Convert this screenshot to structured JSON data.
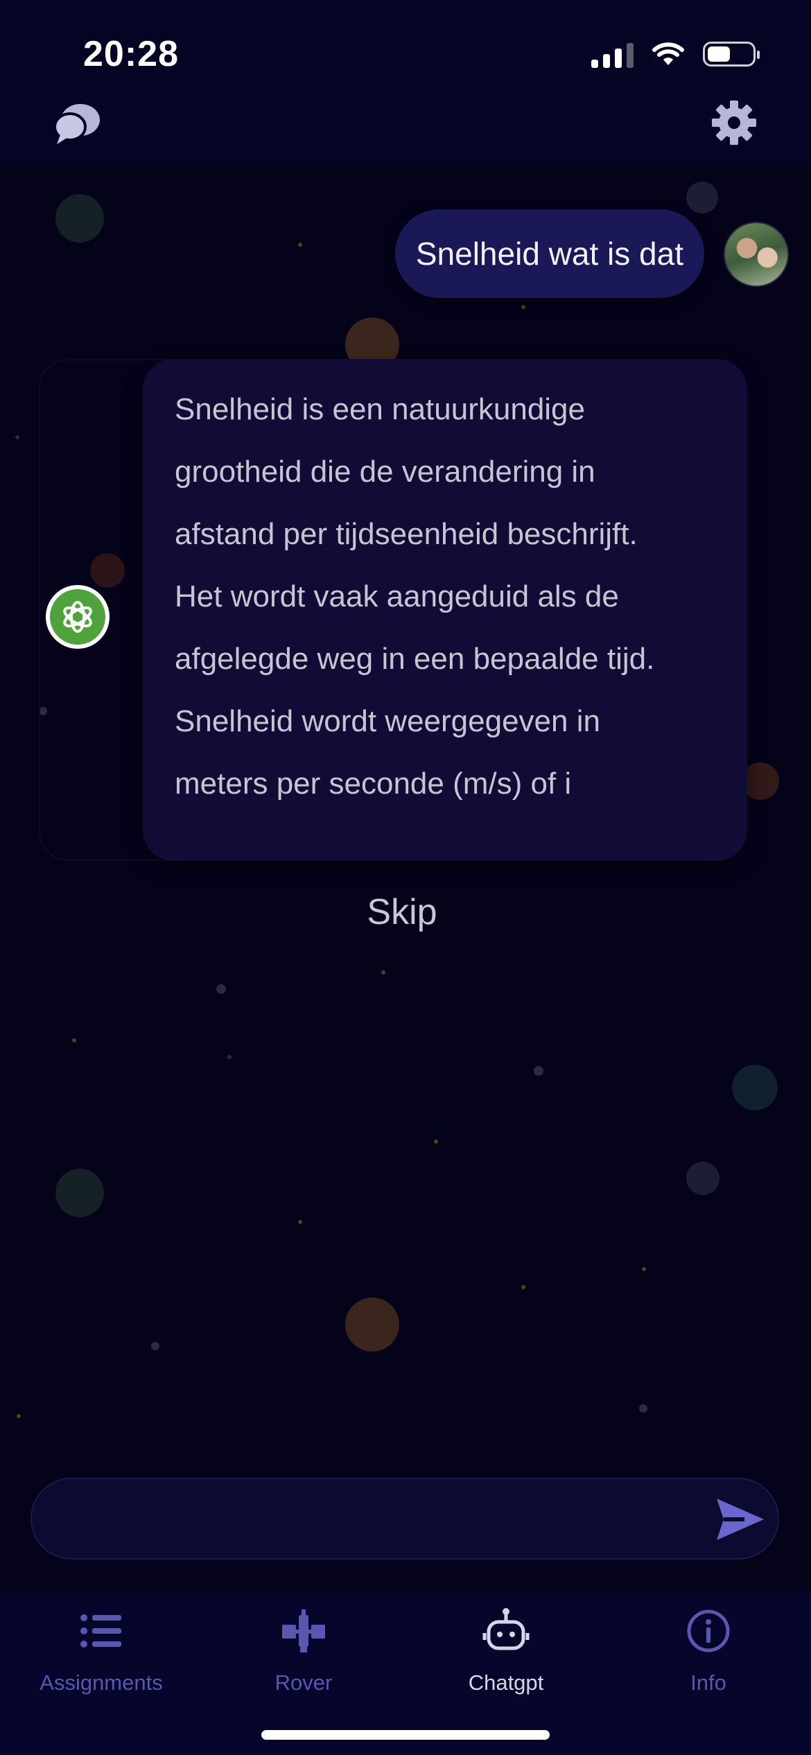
{
  "status_bar": {
    "time": "20:28"
  },
  "header": {
    "left_icon": "chat-bubbles-icon",
    "right_icon": "gear-icon"
  },
  "chat": {
    "user_message": "Snelheid wat is dat",
    "bot_message_lines": [
      "Snelheid is een natuurkundige",
      "grootheid die de verandering in",
      "afstand per tijdseenheid beschrijft.",
      "Het wordt vaak aangeduid als de",
      "afgelegde weg in een bepaalde tijd.",
      "Snelheid wordt weergegeven in",
      "meters per seconde (m/s) of i"
    ],
    "skip_label": "Skip"
  },
  "composer": {
    "placeholder": "",
    "send_icon": "send-icon"
  },
  "tabs": [
    {
      "label": "Assignments",
      "icon": "list-icon",
      "active": false
    },
    {
      "label": "Rover",
      "icon": "satellite-icon",
      "active": false
    },
    {
      "label": "Chatgpt",
      "icon": "robot-icon",
      "active": true
    },
    {
      "label": "Info",
      "icon": "info-icon",
      "active": false
    }
  ],
  "colors": {
    "background": "#04031a",
    "user_bubble": "#1a1857",
    "bot_bubble": "#100c36",
    "tab_inactive": "#5b57b1",
    "tab_active": "#d7d6e6",
    "bot_avatar": "#4fa33d"
  }
}
